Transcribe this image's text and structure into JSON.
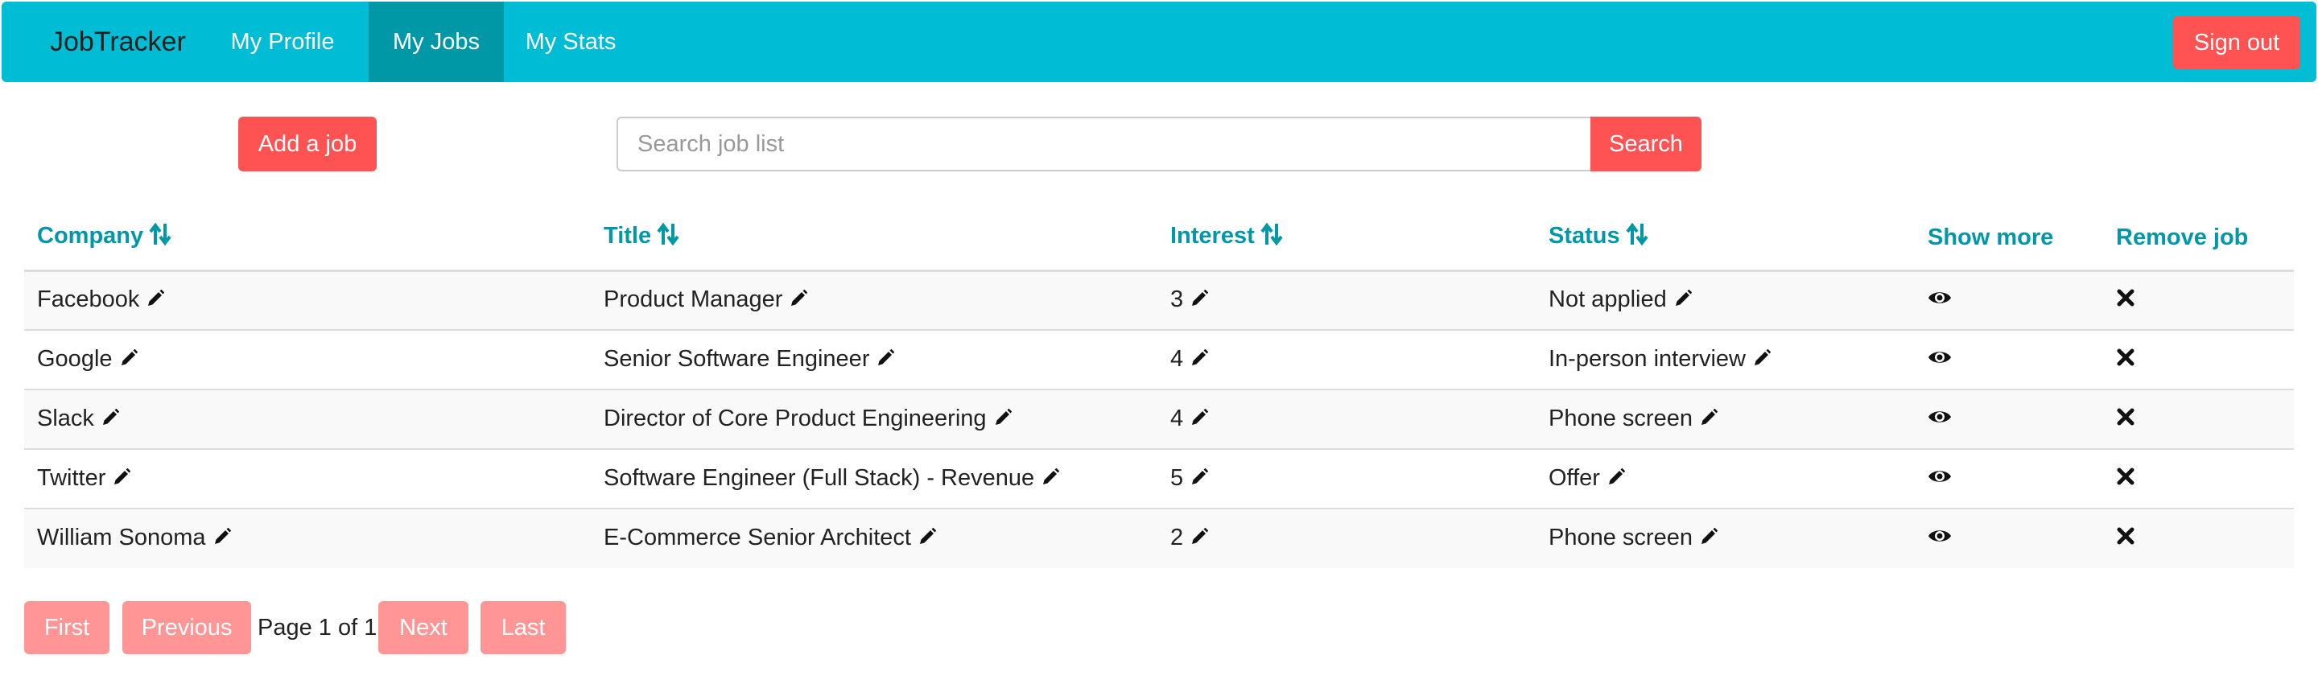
{
  "navbar": {
    "brand": "JobTracker",
    "links": [
      {
        "label": "My Profile",
        "active": false
      },
      {
        "label": "My Jobs",
        "active": true
      },
      {
        "label": "My Stats",
        "active": false
      }
    ],
    "sign_out_label": "Sign out",
    "background_color": "#00bcd4",
    "active_color": "#0097a7"
  },
  "toolbar": {
    "add_job_label": "Add a job",
    "search_placeholder": "Search job list",
    "search_value": "",
    "search_label": "Search",
    "button_color": "#ff5252"
  },
  "table": {
    "columns": [
      "Company",
      "Title",
      "Interest",
      "Status",
      "Show more",
      "Remove job"
    ],
    "sortable_columns": [
      "Company",
      "Title",
      "Interest",
      "Status"
    ],
    "header_color": "#0097a7",
    "rows": [
      {
        "company": "Facebook",
        "title": "Product Manager",
        "interest": "3",
        "status": "Not applied"
      },
      {
        "company": "Google",
        "title": "Senior Software Engineer",
        "interest": "4",
        "status": "In-person interview"
      },
      {
        "company": "Slack",
        "title": "Director of Core Product Engineering",
        "interest": "4",
        "status": "Phone screen"
      },
      {
        "company": "Twitter",
        "title": "Software Engineer (Full Stack) - Revenue",
        "interest": "5",
        "status": "Offer"
      },
      {
        "company": "William Sonoma",
        "title": "E-Commerce Senior Architect",
        "interest": "2",
        "status": "Phone screen"
      }
    ],
    "icons": {
      "sort": "sort-arrows-icon",
      "edit": "pencil-icon",
      "show_more": "eye-icon",
      "remove": "close-icon"
    }
  },
  "pagination": {
    "first_label": "First",
    "previous_label": "Previous",
    "page_text": "Page 1 of 1",
    "next_label": "Next",
    "last_label": "Last",
    "button_color": "#ff9595"
  }
}
